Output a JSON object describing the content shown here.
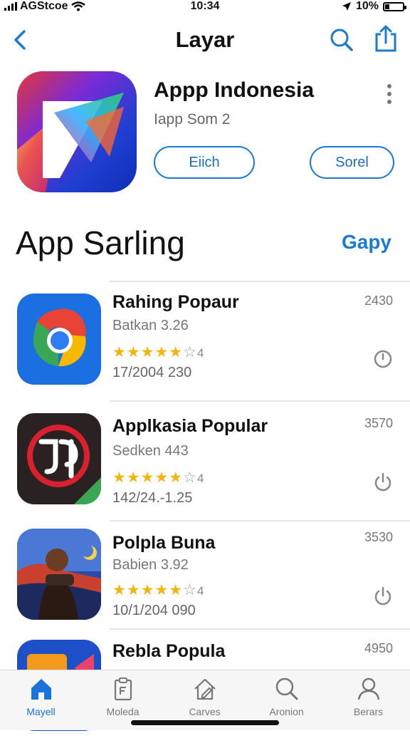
{
  "status": {
    "carrier": "AGStcoe",
    "time": "10:34",
    "battery": "10%"
  },
  "nav": {
    "title": "Layar"
  },
  "featured": {
    "title": "Appp Indonesia",
    "subtitle": "Iapp Som 2",
    "primary_button": "Eiich",
    "secondary_button": "Sorel"
  },
  "section": {
    "title": "App Sarling",
    "link": "Gapy"
  },
  "apps": [
    {
      "name": "Rahing Popaur",
      "sub": "Batkan 3.26",
      "stars": "★★★★★",
      "empty_star": "☆",
      "rating": "4",
      "date": "17/2004 230",
      "count": "2430",
      "icon": "chrome-like-icon",
      "action_icon": "clock-icon"
    },
    {
      "name": "Applkasia Popular",
      "sub": "Sedken 443",
      "stars": "★★★★★",
      "empty_star": "☆",
      "rating": "4",
      "date": "142/24.-1.25",
      "count": "3570",
      "icon": "red-logo-icon",
      "action_icon": "power-icon"
    },
    {
      "name": "Polpla Buna",
      "sub": "Babien 3.92",
      "stars": "★★★★★",
      "empty_star": "☆",
      "rating": "4",
      "date": "10/1/204 090",
      "count": "3530",
      "icon": "photo-icon",
      "action_icon": "power-icon"
    },
    {
      "name": "Rebla Popula",
      "count": "4950",
      "icon": "blue-orange-icon"
    }
  ],
  "tabs": [
    {
      "label": "Mayell",
      "icon": "home-icon",
      "active": true
    },
    {
      "label": "Moleda",
      "icon": "clipboard-icon",
      "active": false
    },
    {
      "label": "Carves",
      "icon": "house-edit-icon",
      "active": false
    },
    {
      "label": "Aronion",
      "icon": "search-icon",
      "active": false
    },
    {
      "label": "Berars",
      "icon": "person-icon",
      "active": false
    }
  ],
  "colors": {
    "accent": "#1a7bd0",
    "star": "#f2b510",
    "tab_active": "#1a73d9"
  }
}
